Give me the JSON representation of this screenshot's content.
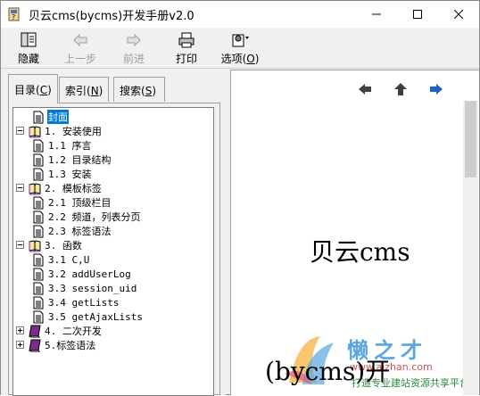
{
  "window": {
    "title": "贝云cms(bycms)开发手册v2.0"
  },
  "toolbar": {
    "hide_label": "隐藏",
    "back_label": "上一步",
    "forward_label": "前进",
    "print_label": "打印",
    "options_label": "选项(",
    "options_accel": "O",
    "options_suffix": ")"
  },
  "tabs": {
    "toc": {
      "label": "目录(",
      "accel": "C",
      "suffix": ")"
    },
    "index": {
      "label": "索引(",
      "accel": "N",
      "suffix": ")"
    },
    "search": {
      "label": "搜索(",
      "accel": "S",
      "suffix": ")"
    }
  },
  "tree": [
    {
      "label": "封面",
      "type": "page",
      "level": 1,
      "selected": true
    },
    {
      "label": "1. 安装使用",
      "type": "book-open",
      "level": 0,
      "expander": "minus"
    },
    {
      "label": "1.1 序言",
      "type": "page",
      "level": 1
    },
    {
      "label": "1.2 目录结构",
      "type": "page",
      "level": 1
    },
    {
      "label": "1.3 安装",
      "type": "page",
      "level": 1
    },
    {
      "label": "2. 模板标签",
      "type": "book-open",
      "level": 0,
      "expander": "minus"
    },
    {
      "label": "2.1 顶级栏目",
      "type": "page",
      "level": 1
    },
    {
      "label": "2.2 频道，列表分页",
      "type": "page",
      "level": 1
    },
    {
      "label": "2.3 标签语法",
      "type": "page",
      "level": 1
    },
    {
      "label": "3. 函数",
      "type": "book-open",
      "level": 0,
      "expander": "minus"
    },
    {
      "label": "3.1 C,U",
      "type": "page",
      "level": 1
    },
    {
      "label": "3.2 addUserLog",
      "type": "page",
      "level": 1
    },
    {
      "label": "3.3 session_uid",
      "type": "page",
      "level": 1
    },
    {
      "label": "3.4 getLists",
      "type": "page",
      "level": 1
    },
    {
      "label": "3.5 getAjaxLists",
      "type": "page",
      "level": 1
    },
    {
      "label": "4. 二次开发",
      "type": "book-closed",
      "level": 0,
      "expander": "plus"
    },
    {
      "label": "5.标签语法",
      "type": "book-closed",
      "level": 0,
      "expander": "plus"
    }
  ],
  "content": {
    "heading_line1": "贝云cms",
    "heading_line2": "(bycms)开"
  },
  "watermark": {
    "brand": "懒之才",
    "url": "www.aizhan.com",
    "slogan": "打造专业建站资源共享平台"
  },
  "colors": {
    "selection": "#0078d7",
    "nav_arrow_blue": "#1e64c8",
    "nav_arrow_gray": "#404040",
    "book_purple": "#7a2e8a"
  }
}
